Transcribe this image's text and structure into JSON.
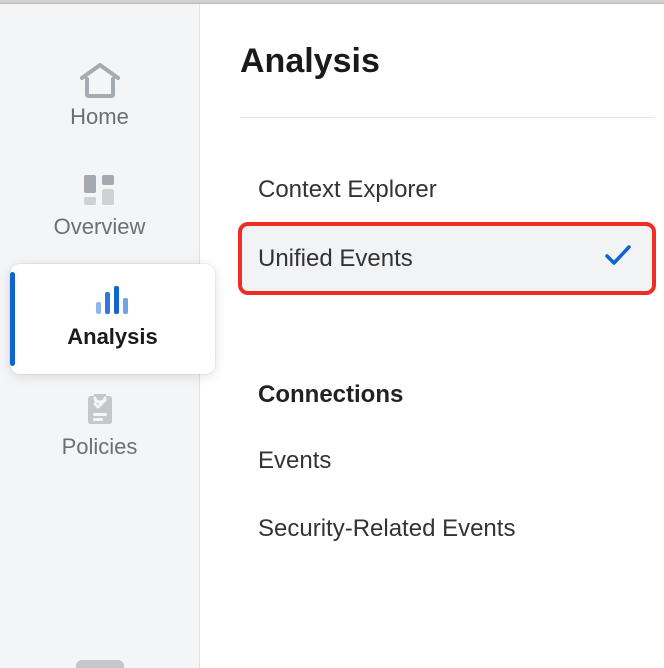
{
  "sidebar": {
    "items": [
      {
        "label": "Home",
        "icon": "home-icon"
      },
      {
        "label": "Overview",
        "icon": "overview-icon"
      },
      {
        "label": "Analysis",
        "icon": "analysis-icon"
      },
      {
        "label": "Policies",
        "icon": "policies-icon"
      }
    ],
    "active_index": 2
  },
  "main": {
    "title": "Analysis",
    "menu": {
      "top_items": [
        {
          "label": "Context Explorer",
          "selected": false,
          "highlighted": false
        },
        {
          "label": "Unified Events",
          "selected": true,
          "highlighted": true
        }
      ],
      "section_header": "Connections",
      "section_items": [
        {
          "label": "Events"
        },
        {
          "label": "Security-Related Events"
        }
      ]
    }
  },
  "colors": {
    "accent": "#0f64d2",
    "highlight_box": "#ee2e24",
    "icon_muted": "#a5a9b0"
  }
}
